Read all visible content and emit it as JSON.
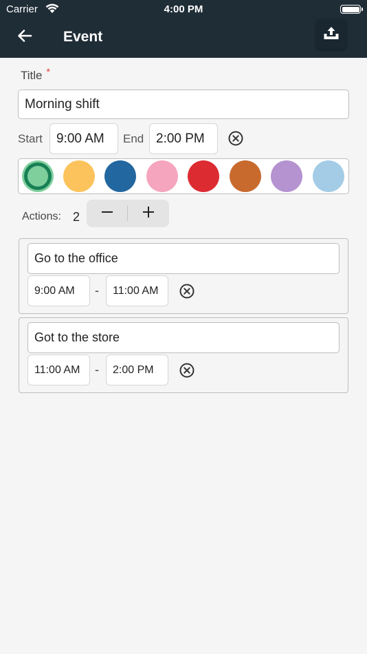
{
  "status_bar": {
    "carrier": "Carrier",
    "time": "4:00 PM"
  },
  "header": {
    "title": "Event"
  },
  "form": {
    "title_label": "Title",
    "required_mark": "*",
    "title_value": "Morning shift",
    "start_label": "Start",
    "start_value": "9:00 AM",
    "end_label": "End",
    "end_value": "2:00 PM"
  },
  "colors": [
    {
      "name": "green",
      "hex": "#7fcf9d",
      "selected": true
    },
    {
      "name": "yellow",
      "hex": "#fcc35c",
      "selected": false
    },
    {
      "name": "blue",
      "hex": "#22679f",
      "selected": false
    },
    {
      "name": "pink",
      "hex": "#f5a5bd",
      "selected": false
    },
    {
      "name": "red",
      "hex": "#dc2b31",
      "selected": false
    },
    {
      "name": "orange",
      "hex": "#c86a2e",
      "selected": false
    },
    {
      "name": "purple",
      "hex": "#b592d0",
      "selected": false
    },
    {
      "name": "light-blue",
      "hex": "#a4cce6",
      "selected": false
    }
  ],
  "actions": {
    "label": "Actions:",
    "count": "2",
    "items": [
      {
        "title": "Go to the office",
        "start": "9:00 AM",
        "end": "11:00 AM",
        "separator": "-"
      },
      {
        "title": "Got to the store",
        "start": "11:00 AM",
        "end": "2:00 PM",
        "separator": "-"
      }
    ]
  },
  "icons": {
    "back": "arrow-left-icon",
    "export": "upload-tray-icon",
    "clear": "circle-x-icon",
    "minus": "minus-icon",
    "plus": "plus-icon"
  }
}
